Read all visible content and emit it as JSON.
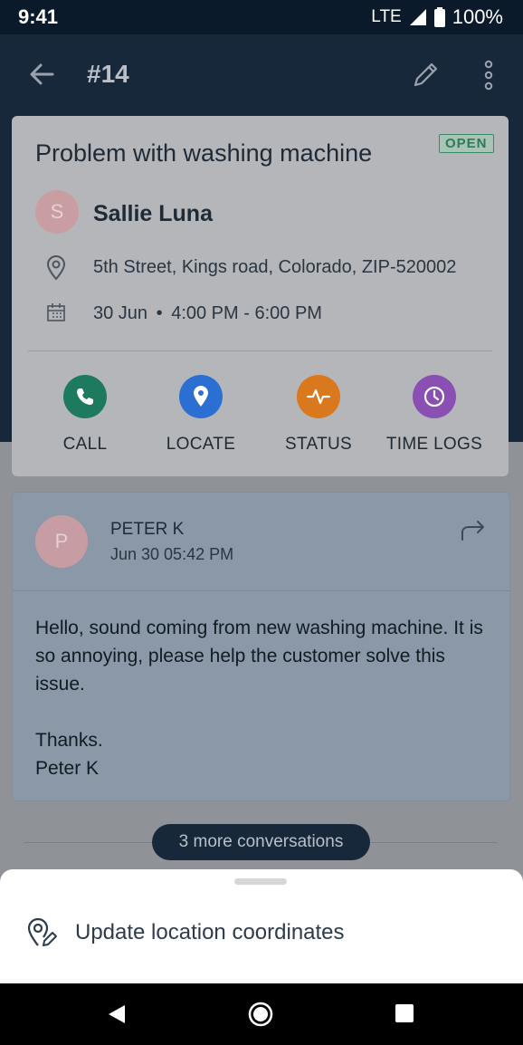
{
  "status_bar": {
    "time": "9:41",
    "network": "LTE",
    "battery": "100%"
  },
  "app_bar": {
    "title": "#14",
    "icons": [
      "back-arrow-icon",
      "pencil-icon",
      "more-vert-icon"
    ]
  },
  "job": {
    "title": "Problem with washing machine",
    "status_badge": "OPEN",
    "customer": {
      "initial": "S",
      "name": "Sallie Luna"
    },
    "address": "5th Street, Kings road, Colorado, ZIP-520002",
    "date": "30 Jun",
    "time_range": "4:00 PM - 6:00 PM",
    "actions": [
      {
        "label": "CALL",
        "icon": "phone-icon",
        "color": "#1d7a5f"
      },
      {
        "label": "LOCATE",
        "icon": "location-pin-icon",
        "color": "#2a6fd1"
      },
      {
        "label": "STATUS",
        "icon": "pulse-icon",
        "color": "#d9781c"
      },
      {
        "label": "TIME LOGS",
        "icon": "clock-icon",
        "color": "#8a4fb3"
      }
    ]
  },
  "conversation": {
    "initial": "P",
    "sender": "PETER K",
    "timestamp": "Jun 30 05:42 PM",
    "body": [
      "Hello, sound coming from new washing machine. It is so annoying, please help the customer solve this issue.",
      "Thanks.",
      "Peter K"
    ]
  },
  "more_conversations": "3 more conversations",
  "bottom_sheet": {
    "item_label": "Update location coordinates",
    "item_icon": "location-edit-icon"
  }
}
